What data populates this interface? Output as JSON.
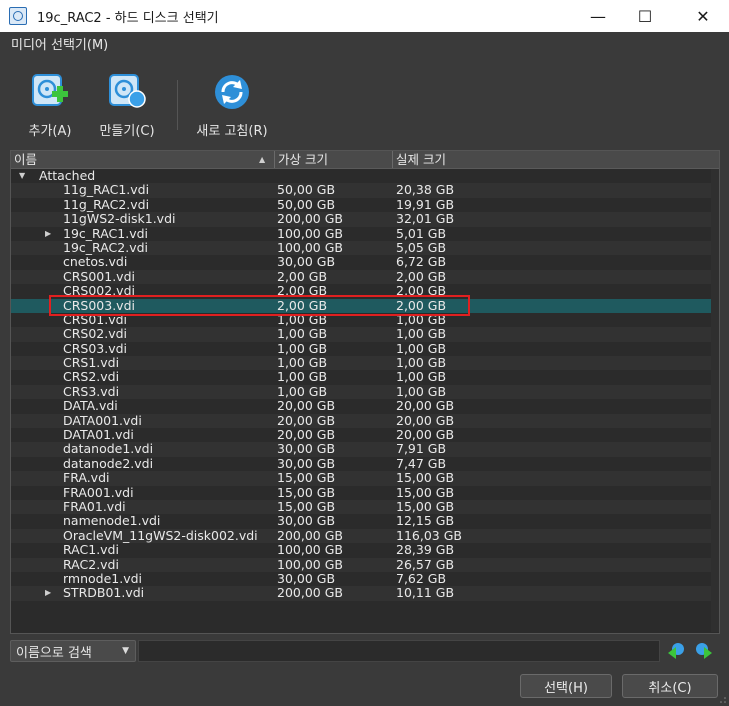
{
  "window": {
    "title": "19c_RAC2 - 하드 디스크 선택기",
    "minimize_glyph": "—",
    "maximize_glyph": "☐",
    "close_glyph": "✕"
  },
  "menu": {
    "media_label": "미디어 선택기(M)"
  },
  "toolbar": {
    "add_label": "추가(A)",
    "create_label": "만들기(C)",
    "refresh_label": "새로 고침(R)",
    "add_icon": "disk-add-icon",
    "create_icon": "disk-create-icon",
    "refresh_icon": "refresh-icon"
  },
  "table": {
    "columns": [
      "이름",
      "가상 크기",
      "실제 크기"
    ],
    "group_label": "Attached",
    "rows": [
      {
        "name": "11g_RAC1.vdi",
        "virtual": "50,00 GB",
        "actual": "20,38 GB"
      },
      {
        "name": "11g_RAC2.vdi",
        "virtual": "50,00 GB",
        "actual": "19,91 GB"
      },
      {
        "name": "11gWS2-disk1.vdi",
        "virtual": "200,00 GB",
        "actual": "32,01 GB"
      },
      {
        "name": "19c_RAC1.vdi",
        "virtual": "100,00 GB",
        "actual": "5,01 GB"
      },
      {
        "name": "19c_RAC2.vdi",
        "virtual": "100,00 GB",
        "actual": "5,05 GB"
      },
      {
        "name": "cnetos.vdi",
        "virtual": "30,00 GB",
        "actual": "6,72 GB"
      },
      {
        "name": "CRS001.vdi",
        "virtual": "2,00 GB",
        "actual": "2,00 GB"
      },
      {
        "name": "CRS002.vdi",
        "virtual": "2,00 GB",
        "actual": "2,00 GB"
      },
      {
        "name": "CRS003.vdi",
        "virtual": "2,00 GB",
        "actual": "2,00 GB"
      },
      {
        "name": "CRS01.vdi",
        "virtual": "1,00 GB",
        "actual": "1,00 GB"
      },
      {
        "name": "CRS02.vdi",
        "virtual": "1,00 GB",
        "actual": "1,00 GB"
      },
      {
        "name": "CRS03.vdi",
        "virtual": "1,00 GB",
        "actual": "1,00 GB"
      },
      {
        "name": "CRS1.vdi",
        "virtual": "1,00 GB",
        "actual": "1,00 GB"
      },
      {
        "name": "CRS2.vdi",
        "virtual": "1,00 GB",
        "actual": "1,00 GB"
      },
      {
        "name": "CRS3.vdi",
        "virtual": "1,00 GB",
        "actual": "1,00 GB"
      },
      {
        "name": "DATA.vdi",
        "virtual": "20,00 GB",
        "actual": "20,00 GB"
      },
      {
        "name": "DATA001.vdi",
        "virtual": "20,00 GB",
        "actual": "20,00 GB"
      },
      {
        "name": "DATA01.vdi",
        "virtual": "20,00 GB",
        "actual": "20,00 GB"
      },
      {
        "name": "datanode1.vdi",
        "virtual": "30,00 GB",
        "actual": "7,91 GB"
      },
      {
        "name": "datanode2.vdi",
        "virtual": "30,00 GB",
        "actual": "7,47 GB"
      },
      {
        "name": "FRA.vdi",
        "virtual": "15,00 GB",
        "actual": "15,00 GB"
      },
      {
        "name": "FRA001.vdi",
        "virtual": "15,00 GB",
        "actual": "15,00 GB"
      },
      {
        "name": "FRA01.vdi",
        "virtual": "15,00 GB",
        "actual": "15,00 GB"
      },
      {
        "name": "namenode1.vdi",
        "virtual": "30,00 GB",
        "actual": "12,15 GB"
      },
      {
        "name": "OracleVM_11gWS2-disk002.vdi",
        "virtual": "200,00 GB",
        "actual": "116,03 GB"
      },
      {
        "name": "RAC1.vdi",
        "virtual": "100,00 GB",
        "actual": "28,39 GB"
      },
      {
        "name": "RAC2.vdi",
        "virtual": "100,00 GB",
        "actual": "26,57 GB"
      },
      {
        "name": "rmnode1.vdi",
        "virtual": "30,00 GB",
        "actual": "7,62 GB"
      },
      {
        "name": "STRDB01.vdi",
        "virtual": "200,00 GB",
        "actual": "10,11 GB"
      }
    ],
    "selected_name": "CRS003.vdi",
    "expandable_names": [
      "19c_RAC1.vdi",
      "STRDB01.vdi"
    ]
  },
  "search": {
    "mode_label": "이름으로 검색",
    "value": ""
  },
  "buttons": {
    "select_label": "선택(H)",
    "cancel_label": "취소(C)"
  },
  "colors": {
    "selection": "#1f5a5f",
    "highlight_box": "#e02020",
    "accent_icon": "#2e8fd8",
    "add_plus": "#3cc43c"
  }
}
